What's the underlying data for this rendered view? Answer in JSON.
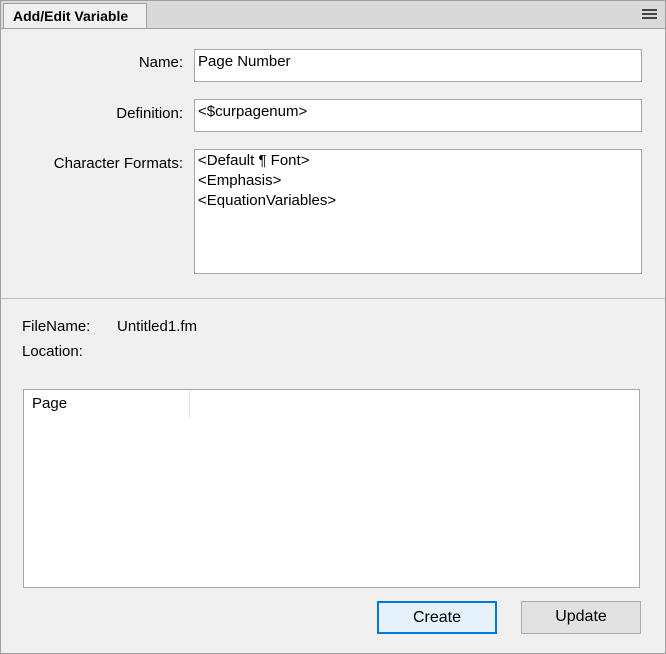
{
  "window": {
    "tab_title": "Add/Edit Variable",
    "menu_icon": "hamburger-menu-icon"
  },
  "form": {
    "name_label": "Name:",
    "name_value": "Page Number",
    "definition_label": "Definition:",
    "definition_value": "<$curpagenum>",
    "char_formats_label": "Character Formats:",
    "char_formats": [
      "<Default ¶ Font>",
      "<Emphasis>",
      "<EquationVariables>"
    ]
  },
  "info": {
    "filename_label": "FileName:",
    "filename_value": "Untitled1.fm",
    "location_label": "Location:"
  },
  "table": {
    "columns": [
      "Page"
    ]
  },
  "buttons": {
    "create": "Create",
    "update": "Update"
  }
}
